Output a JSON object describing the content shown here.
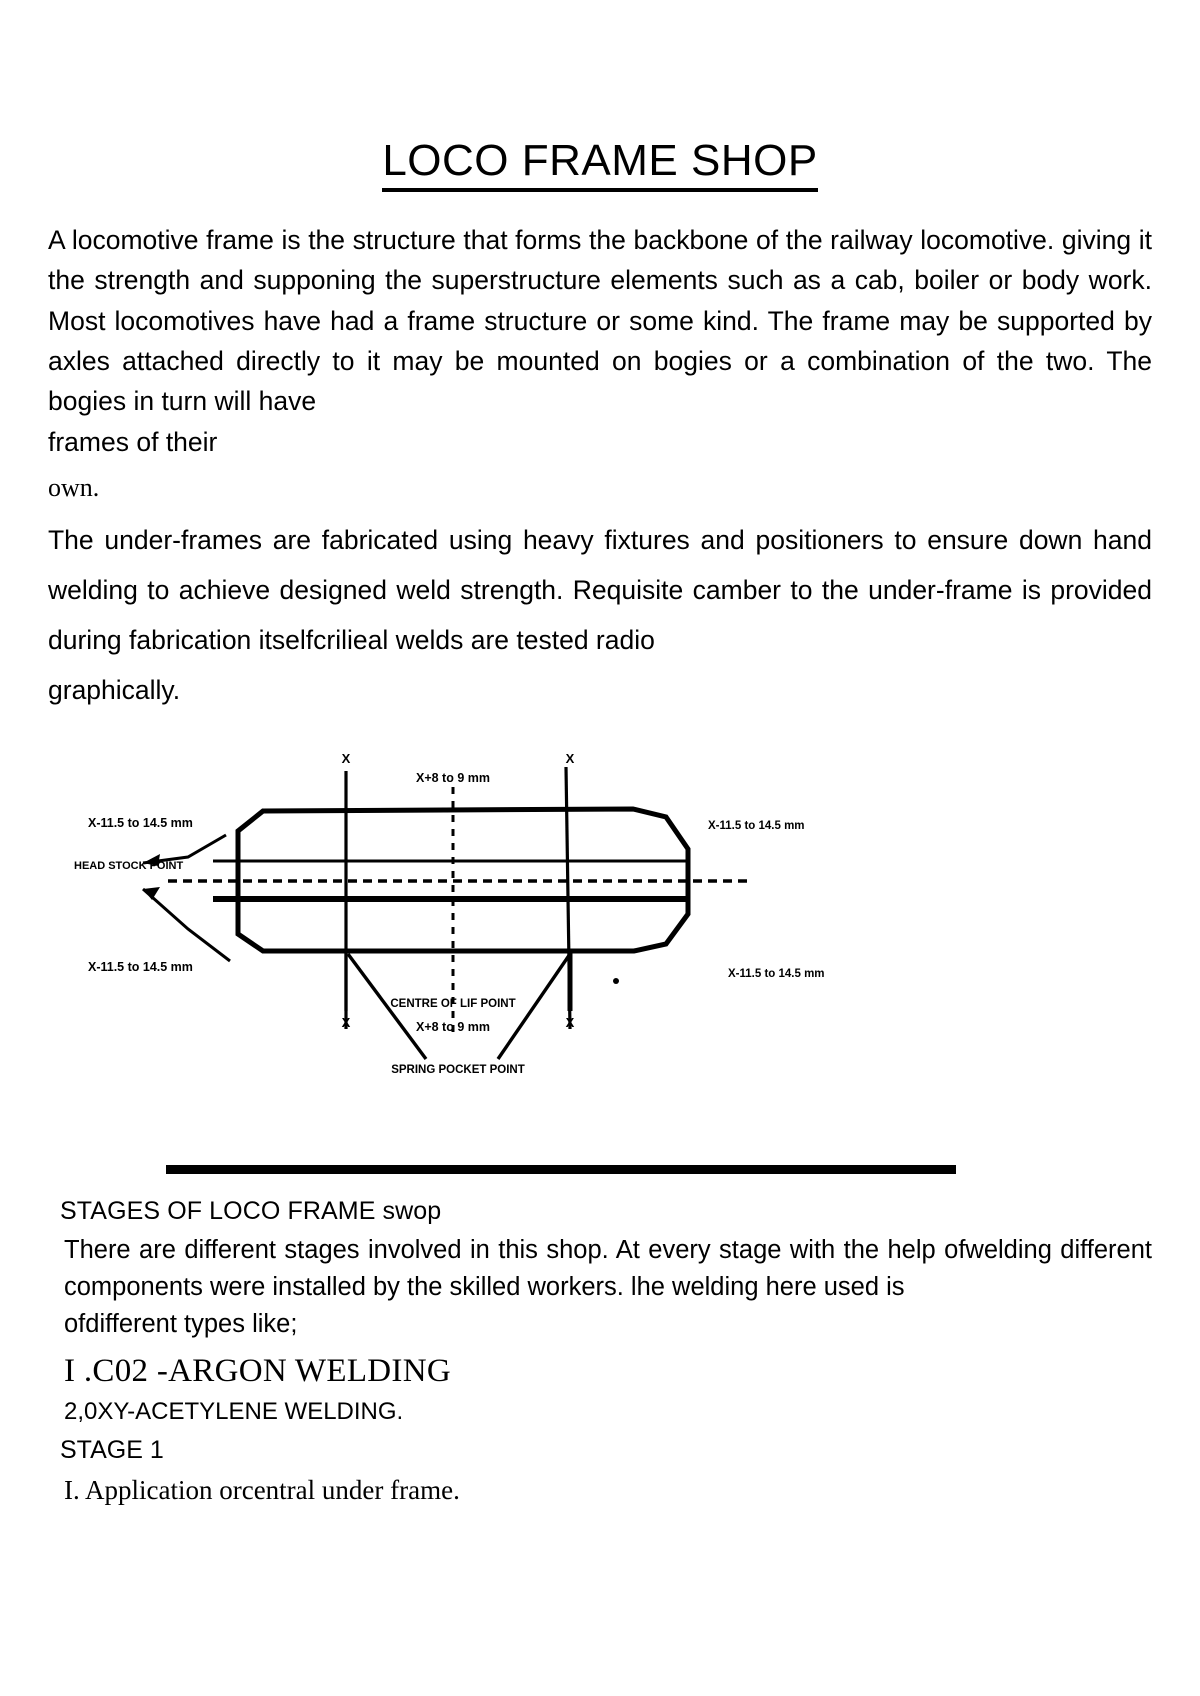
{
  "document": {
    "title": "LOCO FRAME SHOP",
    "paragraph_1": "A locomotive frame is the structure that forms the backbone of the railway locomotive. giving it the strength and supponing the superstructure elements such as a cab, boiler or body work. Most locomotives have had a frame structure or some kind. The frame may be supported by axles attached directly to it may be mounted on bogies or a combination of the two. The bogies in turn will have",
    "paragraph_1_last_line": "frames of their",
    "own_line": "own.",
    "paragraph_2": "The under-frames are fabricated using heavy fixtures and positioners to ensure down hand welding to achieve designed weld strength. Requisite camber to the under-frame is provided during fabrication itselfcrilieal welds are tested radio",
    "paragraph_2_last_line": "graphically.",
    "section_heading": "STAGES OF LOCO FRAME swop",
    "paragraph_3": "There are different stages involved in this shop. At every stage with the help ofwelding different components were installed by the skilled workers. lhe welding here used is",
    "paragraph_3_last_line": "ofdifferent types like;",
    "welding_type_1": "I .C02 -ARGON WELDING",
    "welding_type_2": "2,0XY-ACETYLENE WELDING.",
    "stage_label": "STAGE 1",
    "stage_item_1": "I. Application orcentral under frame."
  },
  "figure": {
    "caption_labels": {
      "top_left": "X-11.5 to 14.5 mm",
      "top_right": "X-11.5 to 14.5 mm",
      "bottom_left": "X-11.5 to 14.5 mm",
      "bottom_right": "X-11.5 to 14.5 mm",
      "top_center": "X+8 to 9 mm",
      "bottom_center": "X+8 to 9 mm",
      "head_stock_point": "HEAD STOCK POINT",
      "centre_lift_point": "CENTRE OF LIF POINT",
      "spring_pocket_point": "SPRING POCKET POINT",
      "axis_top_left": "X",
      "axis_top_right": "X",
      "axis_bottom_left": "X",
      "axis_bottom_right": "X"
    }
  },
  "colors": {
    "ink": "#000000",
    "paper": "#ffffff"
  }
}
